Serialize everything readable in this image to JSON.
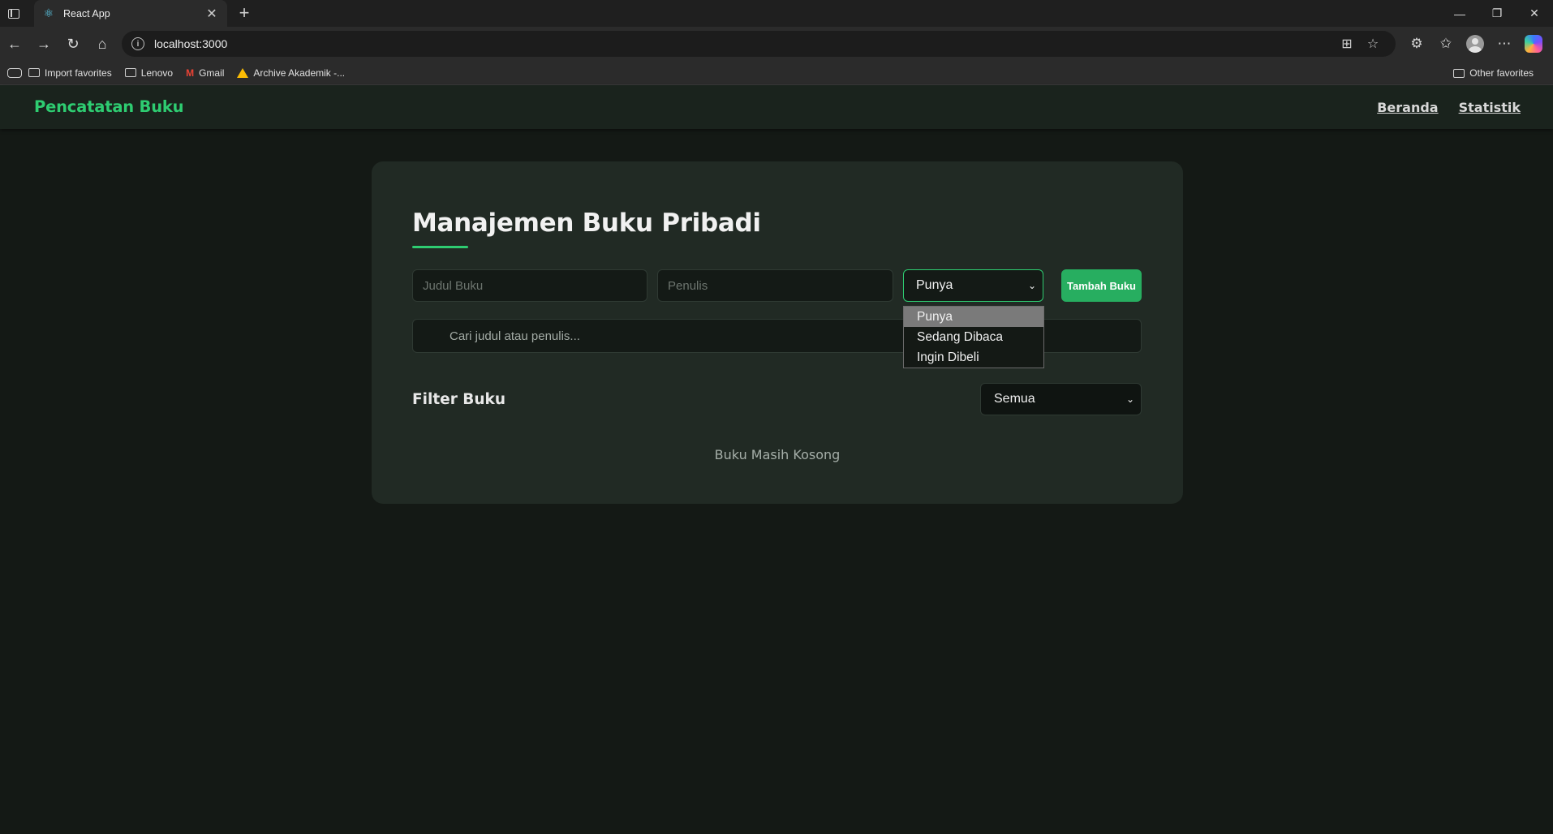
{
  "browser": {
    "tab_title": "React App",
    "url": "localhost:3000",
    "bookmarks": [
      "Import favorites",
      "Lenovo",
      "Gmail",
      "Archive Akademik -..."
    ],
    "other_favorites": "Other favorites"
  },
  "app": {
    "brand": "Pencatatan Buku",
    "nav": [
      "Beranda",
      "Statistik"
    ],
    "title": "Manajemen Buku Pribadi",
    "form": {
      "judul_placeholder": "Judul Buku",
      "penulis_placeholder": "Penulis",
      "status_value": "Punya",
      "submit_label": "Tambah Buku"
    },
    "search_placeholder": "Cari judul atau penulis...",
    "filter": {
      "label": "Filter Buku",
      "value": "Semua"
    },
    "empty_message": "Buku Masih Kosong",
    "status_options": [
      "Punya",
      "Sedang Dibaca",
      "Ingin Dibeli"
    ],
    "accent_color": "#2ecc71"
  }
}
